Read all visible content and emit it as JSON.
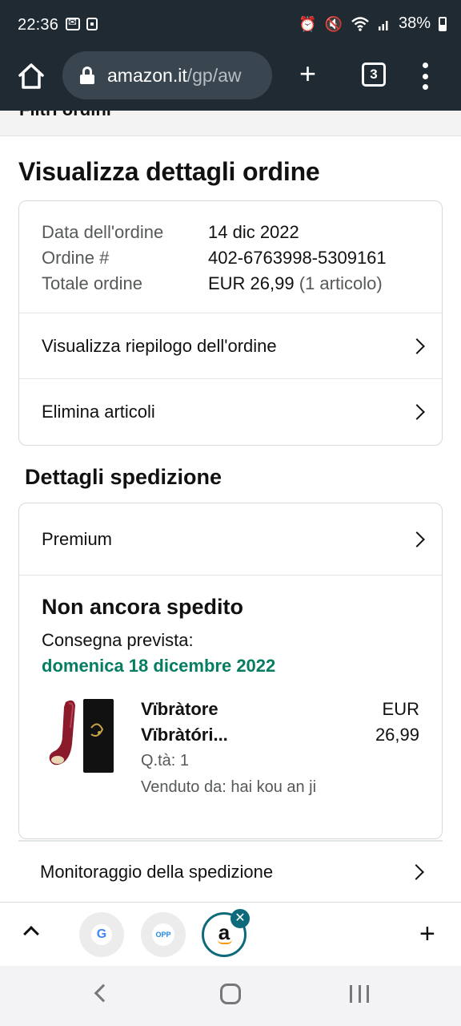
{
  "status_bar": {
    "time": "22:36",
    "battery": "38%",
    "icons": [
      "mail-notification-icon",
      "app-notification-icon",
      "alarm-icon",
      "mute-icon",
      "wifi-icon",
      "signal-icon",
      "battery-icon"
    ]
  },
  "browser": {
    "url_host": "amazon.it",
    "url_path": "/gp/aw",
    "tab_count": "3",
    "icons": [
      "home-icon",
      "lock-icon",
      "new-tab-icon",
      "tab-switcher-icon",
      "menu-icon"
    ]
  },
  "page": {
    "filter_text": "Filtri ordini",
    "title": "Visualizza dettagli ordine",
    "order": {
      "date_label": "Data dell'ordine",
      "date_value": "14 dic 2022",
      "number_label": "Ordine #",
      "number_value": "402-6763998-5309161",
      "total_label": "Totale ordine",
      "total_value": "EUR 26,99",
      "total_items": "(1 articolo)"
    },
    "links": {
      "summary": "Visualizza riepilogo dell'ordine",
      "delete": "Elimina articoli"
    },
    "shipping": {
      "section_title": "Dettagli spedizione",
      "service": "Premium",
      "status": "Non ancora spedito",
      "delivery_label": "Consegna prevista:",
      "delivery_date": "domenica 18 dicembre 2022",
      "delivery_color": "#067d62",
      "item": {
        "name_line1": "Vïbràtore",
        "name_line2": "Vïbràtóri...",
        "quantity": "Q.tà: 1",
        "seller": "Venduto da: hai kou an ji",
        "currency": "EUR",
        "price": "26,99"
      },
      "tracking": "Monitoraggio della spedizione"
    }
  },
  "tab_bar": {
    "google_label": "G",
    "opp_label": "OPP",
    "amazon_label": "a",
    "close_label": "✕",
    "accent_color": "#0e6a7a"
  }
}
